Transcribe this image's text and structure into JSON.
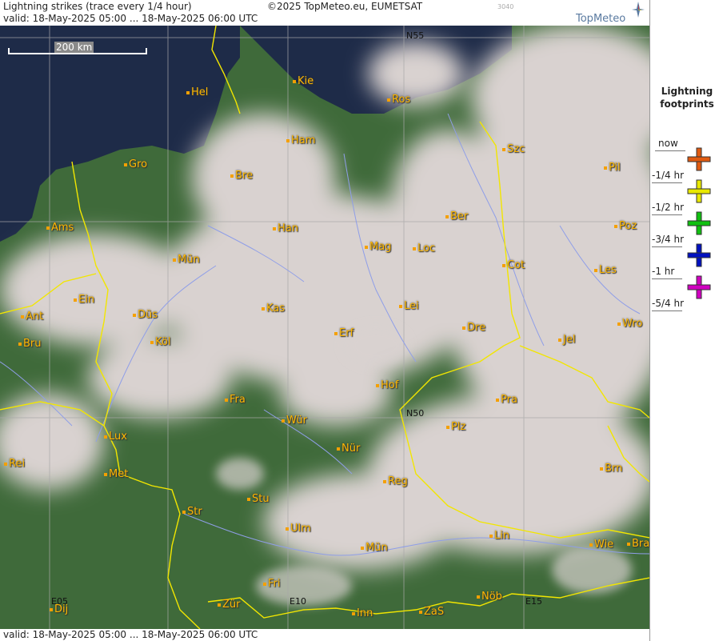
{
  "header": {
    "title": "Lightning strikes (trace every 1/4 hour)",
    "copyright": "©2025 TopMeteo.eu, EUMETSAT",
    "valid": "valid:  18-May-2025 05:00 ... 18-May-2025 06:00 UTC",
    "code": "3040",
    "logo": "TopMeteo"
  },
  "footer": {
    "valid": "valid:  18-May-2025 05:00 ... 18-May-2025 06:00 UTC"
  },
  "map": {
    "scale": "200 km",
    "grid": {
      "n55": "N55",
      "n50": "N50",
      "e05": "E05",
      "e10": "E10",
      "e15": "E15"
    },
    "cities": [
      {
        "name": "Kie"
      },
      {
        "name": "Hel"
      },
      {
        "name": "Ros"
      },
      {
        "name": "Ham"
      },
      {
        "name": "Szc"
      },
      {
        "name": "Gro"
      },
      {
        "name": "Bre"
      },
      {
        "name": "Pil"
      },
      {
        "name": "Ber"
      },
      {
        "name": "Ams"
      },
      {
        "name": "Han"
      },
      {
        "name": "Poz"
      },
      {
        "name": "Mag"
      },
      {
        "name": "Loc"
      },
      {
        "name": "Mün"
      },
      {
        "name": "Cot"
      },
      {
        "name": "Les"
      },
      {
        "name": "Ein"
      },
      {
        "name": "Kas"
      },
      {
        "name": "Lei"
      },
      {
        "name": "Ant"
      },
      {
        "name": "Düs"
      },
      {
        "name": "Wro"
      },
      {
        "name": "Erf"
      },
      {
        "name": "Dre"
      },
      {
        "name": "Bru"
      },
      {
        "name": "Köl"
      },
      {
        "name": "Jel"
      },
      {
        "name": "Hof"
      },
      {
        "name": "Fra"
      },
      {
        "name": "Pra"
      },
      {
        "name": "Wür"
      },
      {
        "name": "Plz"
      },
      {
        "name": "Lux"
      },
      {
        "name": "Nür"
      },
      {
        "name": "Rei"
      },
      {
        "name": "Brn"
      },
      {
        "name": "Met"
      },
      {
        "name": "Reg"
      },
      {
        "name": "Stu"
      },
      {
        "name": "Str"
      },
      {
        "name": "Ulm"
      },
      {
        "name": "Lin"
      },
      {
        "name": "Mün"
      },
      {
        "name": "Wie"
      },
      {
        "name": "Bra"
      },
      {
        "name": "Fri"
      },
      {
        "name": "Nöb"
      },
      {
        "name": "Dij"
      },
      {
        "name": "Zür"
      },
      {
        "name": "Inn"
      },
      {
        "name": "ZaS"
      }
    ],
    "colors": {
      "sea": "#1e2b48",
      "land": "#3f6a3a",
      "cloud": "#d9d2d0",
      "border": "#f2e600",
      "river": "#8f9ee8",
      "city": "#ffb800"
    }
  },
  "legend": {
    "title_line1": "Lightning",
    "title_line2": "footprints",
    "items": [
      {
        "label": "now",
        "color": ""
      },
      {
        "label": "-1/4 hr",
        "color": "#e05a10"
      },
      {
        "label": "-1/2 hr",
        "color": "#e8e800"
      },
      {
        "label": "-3/4 hr",
        "color": "#10c010"
      },
      {
        "label": "-1 hr",
        "color": "#0010c0"
      },
      {
        "label": "-5/4 hr",
        "color": "#d000c0"
      }
    ]
  }
}
